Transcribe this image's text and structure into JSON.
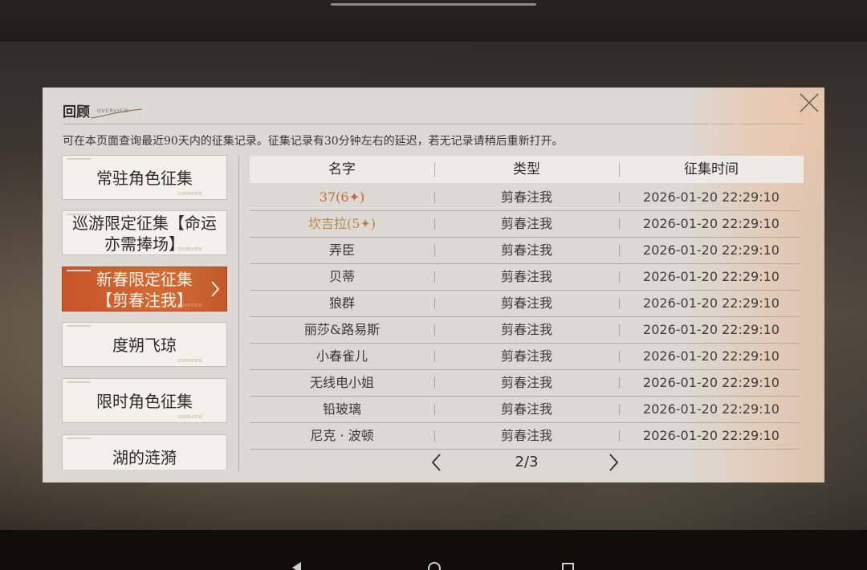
{
  "panel": {
    "title": "回顾",
    "subtitle": "OVERVIEW",
    "notice": "可在本页面查询最近90天内的征集记录。征集记录有30分钟左右的延迟，若无记录请稍后重新打开。"
  },
  "categories": [
    {
      "label": "常驻角色征集",
      "active": false
    },
    {
      "label": "巡游限定征集【命运\n亦需捧场】",
      "active": false
    },
    {
      "label": "新春限定征集\n【剪春注我】",
      "active": true
    },
    {
      "label": "度朔飞琼",
      "active": false
    },
    {
      "label": "限时角色征集",
      "active": false
    },
    {
      "label": "湖的涟漪",
      "active": false
    }
  ],
  "category_overview_tag": "OVERVIEW",
  "table": {
    "headers": {
      "name": "名字",
      "type": "类型",
      "time": "征集时间"
    },
    "rows": [
      {
        "name": "37(6✦)",
        "type": "剪春注我",
        "time": "2026-01-20 22:29:10",
        "rarity": 6
      },
      {
        "name": "坎吉拉(5✦)",
        "type": "剪春注我",
        "time": "2026-01-20 22:29:10",
        "rarity": 5
      },
      {
        "name": "弄臣",
        "type": "剪春注我",
        "time": "2026-01-20 22:29:10",
        "rarity": 0
      },
      {
        "name": "贝蒂",
        "type": "剪春注我",
        "time": "2026-01-20 22:29:10",
        "rarity": 0
      },
      {
        "name": "狼群",
        "type": "剪春注我",
        "time": "2026-01-20 22:29:10",
        "rarity": 0
      },
      {
        "name": "丽莎&路易斯",
        "type": "剪春注我",
        "time": "2026-01-20 22:29:10",
        "rarity": 0
      },
      {
        "name": "小春雀儿",
        "type": "剪春注我",
        "time": "2026-01-20 22:29:10",
        "rarity": 0
      },
      {
        "name": "无线电小姐",
        "type": "剪春注我",
        "time": "2026-01-20 22:29:10",
        "rarity": 0
      },
      {
        "name": "铅玻璃",
        "type": "剪春注我",
        "time": "2026-01-20 22:29:10",
        "rarity": 0
      },
      {
        "name": "尼克 · 波顿",
        "type": "剪春注我",
        "time": "2026-01-20 22:29:10",
        "rarity": 0
      }
    ]
  },
  "pager": {
    "label": "2/3",
    "current": 2,
    "total": 3
  },
  "icons": {
    "close": "close-icon",
    "prev": "chevron-left-icon",
    "next": "chevron-right-icon",
    "active_chevron": "chevron-right-icon"
  },
  "colors": {
    "accent_active": "#c7552a",
    "rarity6": "#c26a37",
    "rarity5": "#b58a45"
  }
}
